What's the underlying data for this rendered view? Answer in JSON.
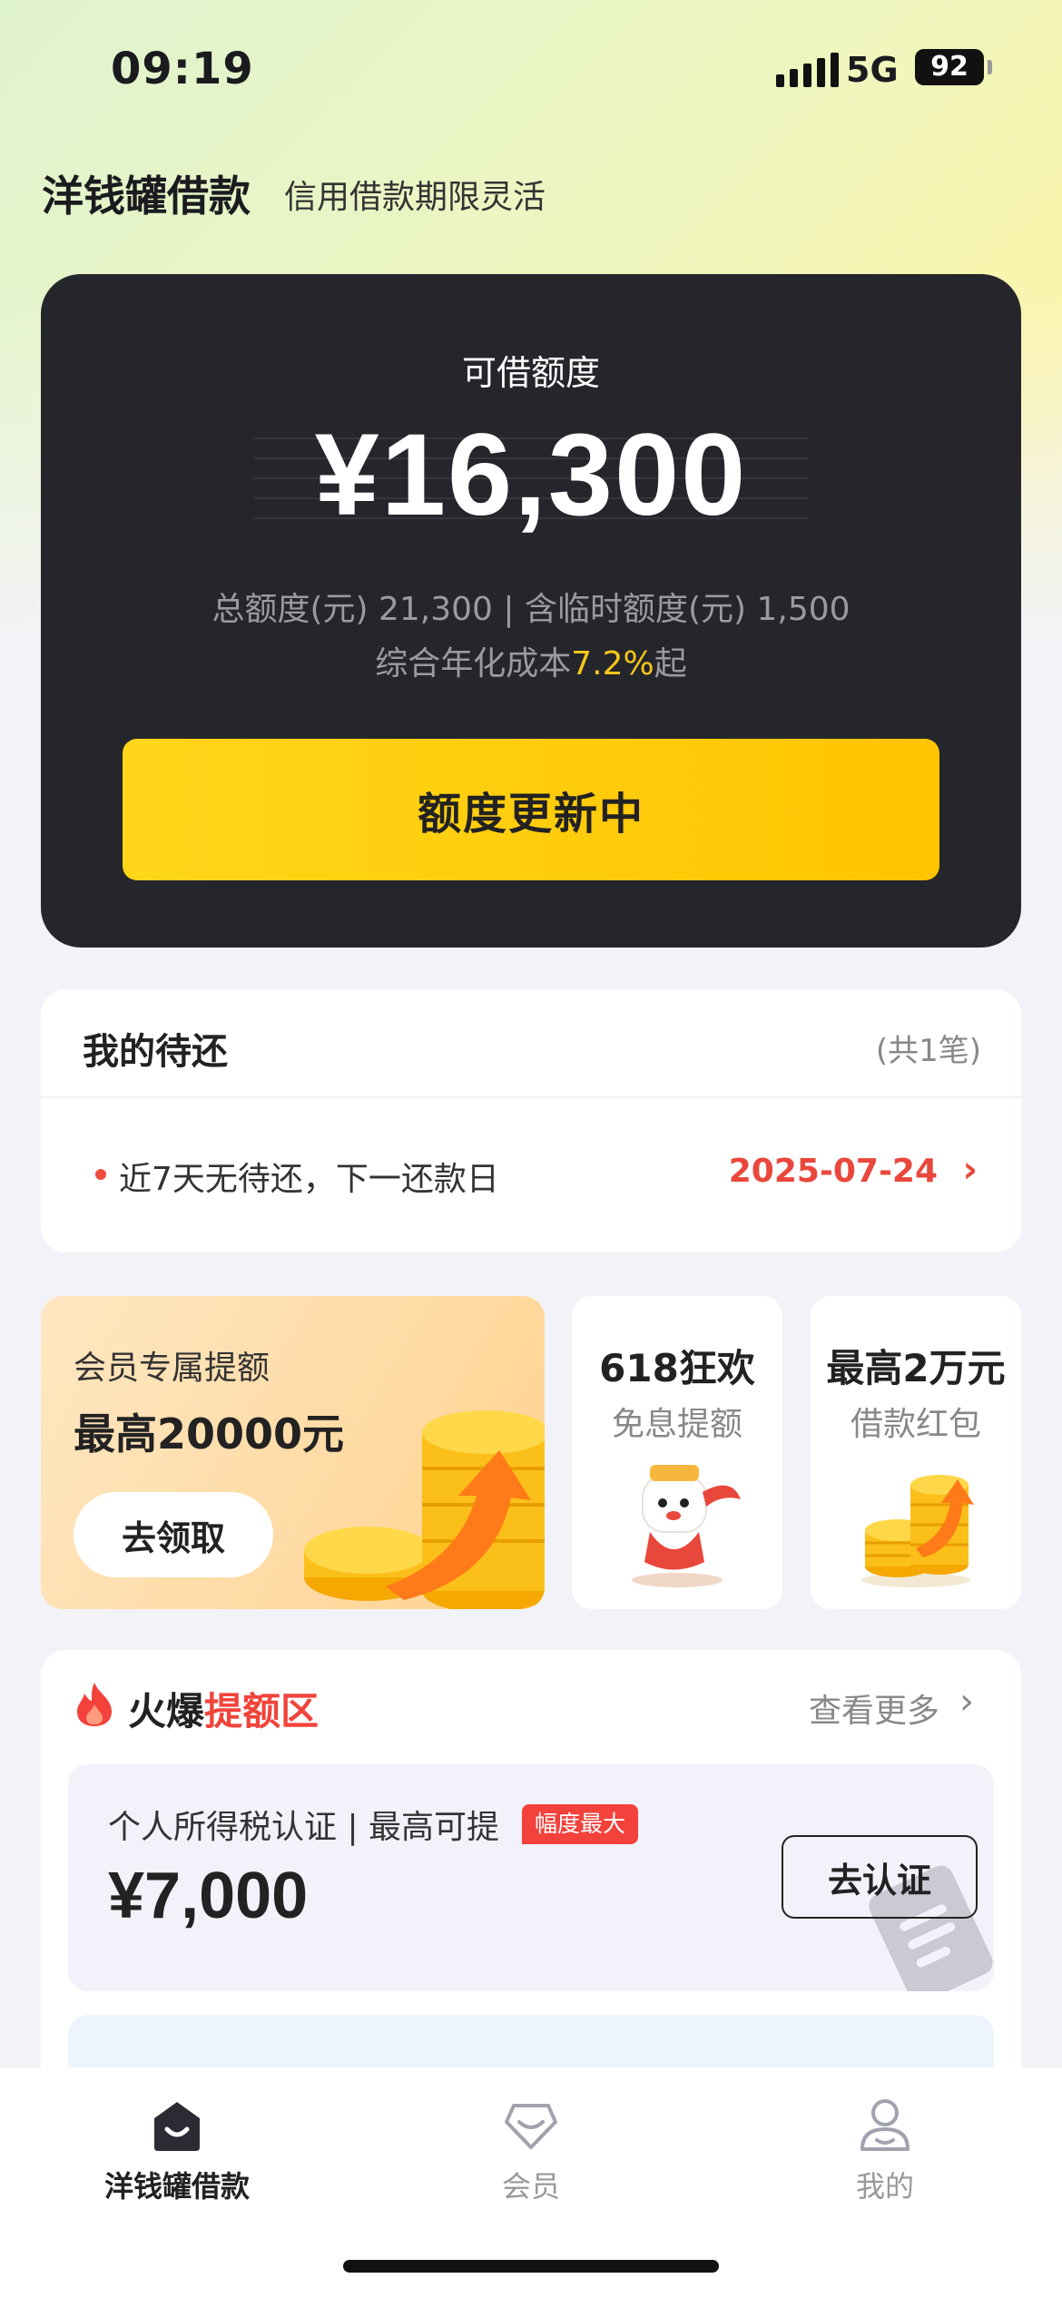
{
  "status_bar": {
    "time": "09:19",
    "network": "5G",
    "battery": "92"
  },
  "header": {
    "title": "洋钱罐借款",
    "subtitle": "信用借款期限灵活"
  },
  "credit": {
    "label": "可借额度",
    "amount": "¥16,300",
    "total_line": "总额度(元) 21,300 | 含临时额度(元) 1,500",
    "rate_prefix": "综合年化成本",
    "rate_value": "7.2%",
    "rate_suffix": "起",
    "button_label": "额度更新中"
  },
  "repayment": {
    "title": "我的待还",
    "count": "(共1笔)",
    "message": "近7天无待还，下一还款日",
    "next_date": "2025-07-24"
  },
  "promos": {
    "member": {
      "line1": "会员专属提额",
      "line2": "最高20000元",
      "button": "去领取"
    },
    "festival": {
      "title": "618狂欢",
      "subtitle": "免息提额"
    },
    "coupon": {
      "title": "最高2万元",
      "subtitle": "借款红包"
    }
  },
  "hot_section": {
    "title_prefix": "火爆",
    "title_highlight": "提额区",
    "more": "查看更多",
    "tax_card": {
      "label": "个人所得税认证 | 最高可提",
      "badge": "幅度最大",
      "amount": "¥7,000",
      "button": "去认证"
    }
  },
  "tabbar": {
    "home": "洋钱罐借款",
    "vip": "会员",
    "me": "我的"
  },
  "colors": {
    "accent_yellow": "#ffc400",
    "highlight_red": "#f0443b",
    "dark_card": "#25262b",
    "rate_highlight": "#f7c71b"
  },
  "icons": [
    "signal-icon",
    "battery-icon",
    "chevron-right-icon",
    "fire-icon",
    "document-icon",
    "home-icon",
    "vip-icon",
    "user-icon"
  ]
}
